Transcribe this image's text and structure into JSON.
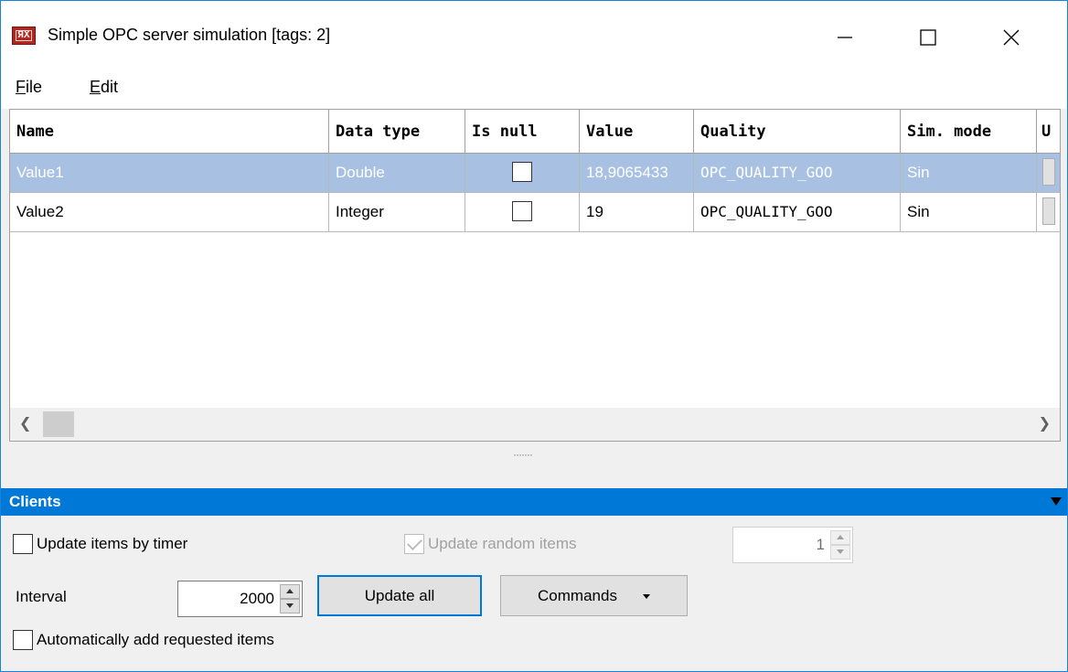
{
  "window": {
    "title": "Simple OPC server simulation [tags: 2]",
    "app_icon_text": "ЯX"
  },
  "menu": {
    "file": {
      "mnemonic": "F",
      "rest": "ile"
    },
    "edit": {
      "mnemonic": "E",
      "rest": "dit"
    }
  },
  "grid": {
    "columns": [
      "Name",
      "Data type",
      "Is null",
      "Value",
      "Quality",
      "Sim. mode",
      "U"
    ],
    "rows": [
      {
        "name": "Value1",
        "data_type": "Double",
        "value": "18,9065433",
        "quality": "OPC_QUALITY_GOO",
        "sim_mode": "Sin",
        "selected": true
      },
      {
        "name": "Value2",
        "data_type": "Integer",
        "value": "19",
        "quality": "OPC_QUALITY_GOO",
        "sim_mode": "Sin",
        "selected": false
      }
    ]
  },
  "splitter": {
    "grip": "·······"
  },
  "clients": {
    "header": "Clients",
    "update_by_timer": {
      "label": "Update items by timer",
      "checked": false
    },
    "update_random": {
      "label": "Update random items",
      "checked": true,
      "enabled": false
    },
    "random_count": "1",
    "interval_label": "Interval",
    "interval_value": "2000",
    "update_all_label": "Update all",
    "commands_label": "Commands",
    "auto_add": {
      "label": "Automatically add requested items",
      "checked": false
    }
  },
  "colors": {
    "accent": "#0078d7",
    "selection": "#a8c1e2",
    "panel_header": "#0078d7"
  }
}
